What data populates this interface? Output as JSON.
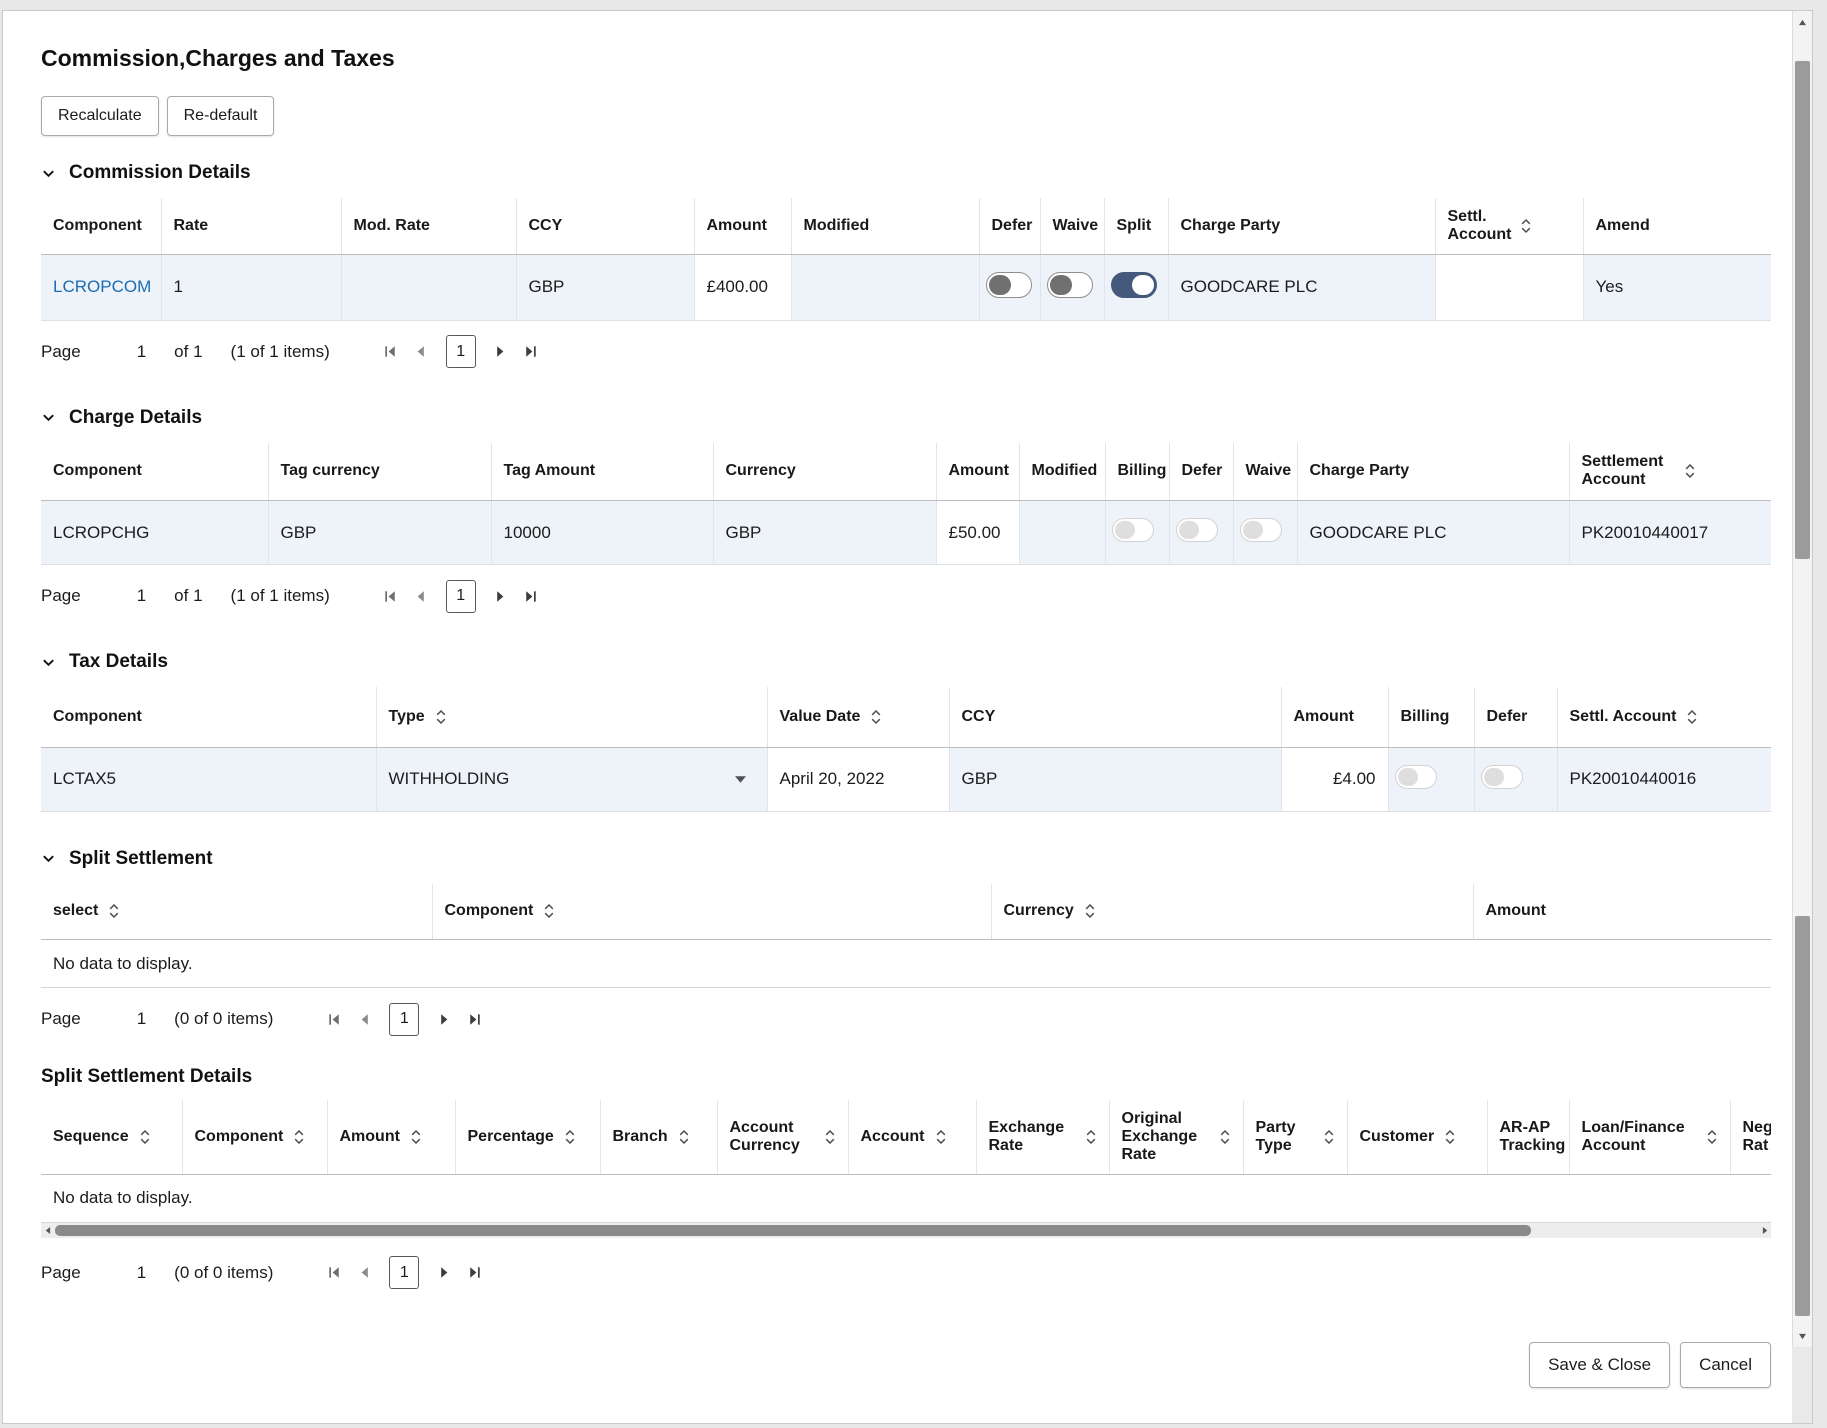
{
  "colors": {
    "row_highlight": "#eef2f9",
    "link": "#1b6db3",
    "toggle_on": "#44597c"
  },
  "icons": {
    "section_chevron": "chevron-down",
    "sort": "sort-up-down",
    "select_caret": "caret-down",
    "pagination": [
      "first-page",
      "previous-page",
      "next-page",
      "last-page"
    ]
  },
  "page": {
    "title": "Commission,Charges and Taxes"
  },
  "toolbar": {
    "recalculate_label": "Recalculate",
    "redefault_label": "Re-default"
  },
  "commission_details": {
    "title": "Commission Details",
    "columns": [
      "Component",
      "Rate",
      "Mod. Rate",
      "CCY",
      "Amount",
      "Modified",
      "Defer",
      "Waive",
      "Split",
      "Charge Party",
      "Settl. Account",
      "Amend"
    ],
    "row": {
      "component": "LCROPCOM",
      "rate": "1",
      "mod_rate": "",
      "ccy": "GBP",
      "amount": "£400.00",
      "modified": "",
      "defer_on": false,
      "waive_on": false,
      "split_on": true,
      "charge_party": "GOODCARE PLC",
      "settl_account": "",
      "amend": "Yes"
    },
    "pagination": {
      "label": "Page",
      "page": "1",
      "of_text": "of 1",
      "items_text": "(1 of 1 items)",
      "current_page": "1"
    }
  },
  "charge_details": {
    "title": "Charge Details",
    "columns": [
      "Component",
      "Tag currency",
      "Tag Amount",
      "Currency",
      "Amount",
      "Modified",
      "Billing",
      "Defer",
      "Waive",
      "Charge Party",
      "Settlement Account"
    ],
    "row": {
      "component": "LCROPCHG",
      "tag_currency": "GBP",
      "tag_amount": "10000",
      "currency": "GBP",
      "amount": "£50.00",
      "modified": "",
      "billing_on": false,
      "defer_on": false,
      "waive_on": false,
      "charge_party": "GOODCARE PLC",
      "settlement_account": "PK20010440017"
    },
    "pagination": {
      "label": "Page",
      "page": "1",
      "of_text": "of 1",
      "items_text": "(1 of 1 items)",
      "current_page": "1"
    }
  },
  "tax_details": {
    "title": "Tax Details",
    "columns": [
      "Component",
      "Type",
      "Value Date",
      "CCY",
      "Amount",
      "Billing",
      "Defer",
      "Settl. Account"
    ],
    "row": {
      "component": "LCTAX5",
      "type": "WITHHOLDING",
      "value_date": "April 20, 2022",
      "ccy": "GBP",
      "amount": "£4.00",
      "billing_on": false,
      "defer_on": false,
      "settl_account": "PK20010440016"
    }
  },
  "split_settlement": {
    "title": "Split Settlement",
    "columns": [
      "select",
      "Component",
      "Currency",
      "Amount"
    ],
    "empty_text": "No data to display.",
    "pagination": {
      "label": "Page",
      "page": "1",
      "items_text": "(0 of 0 items)",
      "current_page": "1"
    }
  },
  "split_settlement_details": {
    "title": "Split Settlement Details",
    "columns": [
      "Sequence",
      "Component",
      "Amount",
      "Percentage",
      "Branch",
      "Account Currency",
      "Account",
      "Exchange Rate",
      "Original Exchange Rate",
      "Party Type",
      "Customer",
      "AR-AP Tracking",
      "Loan/Finance Account",
      "Neg Rat"
    ],
    "empty_text": "No data to display.",
    "pagination": {
      "label": "Page",
      "page": "1",
      "items_text": "(0 of 0 items)",
      "current_page": "1"
    }
  },
  "footer": {
    "save_close_label": "Save & Close",
    "cancel_label": "Cancel"
  }
}
